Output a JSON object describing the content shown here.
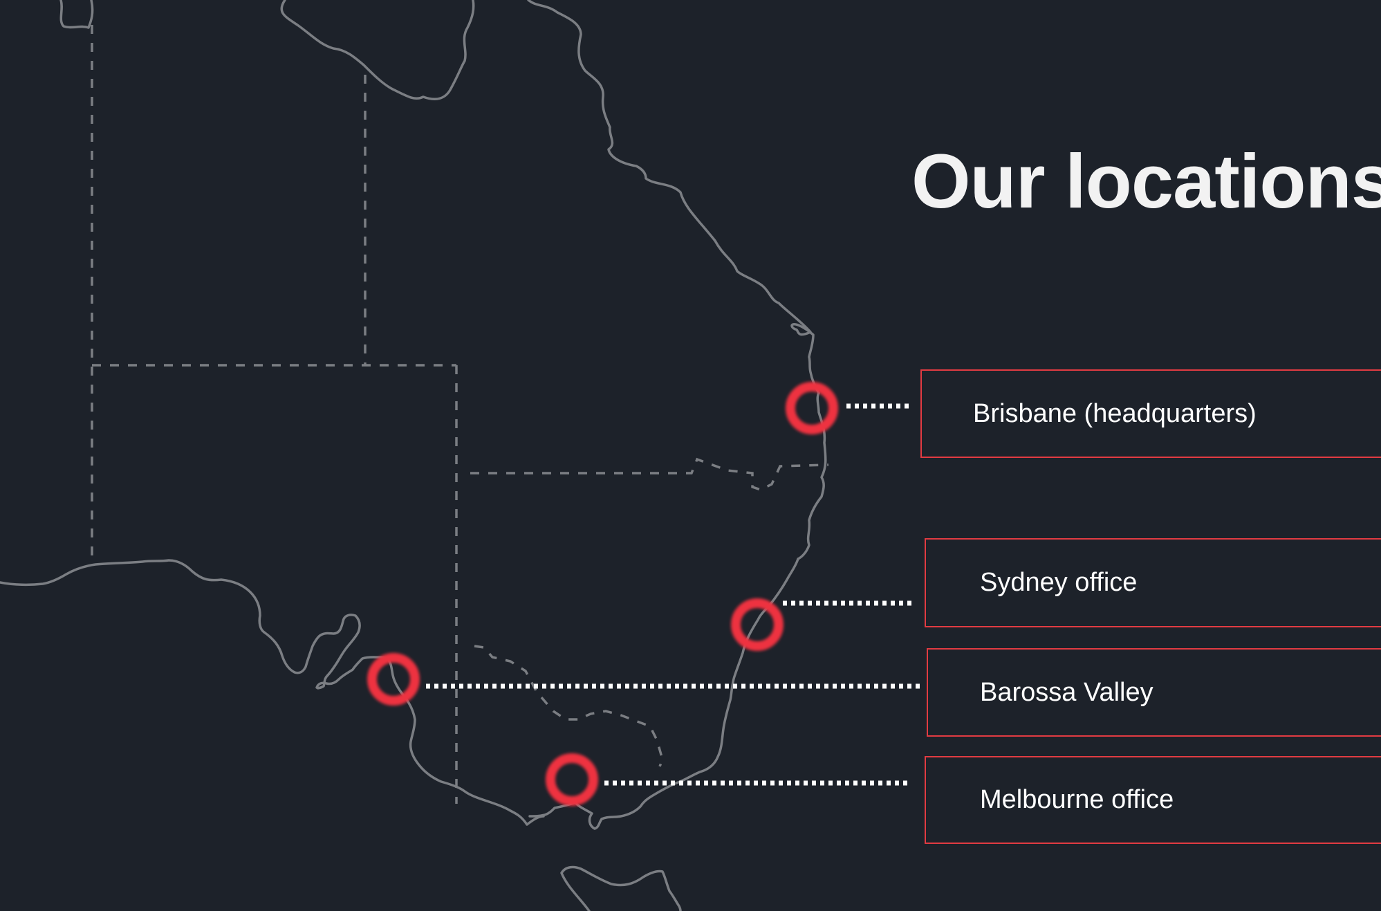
{
  "title": "Our locations",
  "colors": {
    "background": "#1d222a",
    "pin": "#ee3340",
    "box_border": "#e23b42",
    "coastline": "#7b7e83",
    "leader_line": "#ffffff"
  },
  "locations": [
    {
      "label": "Brisbane (headquarters)"
    },
    {
      "label": "Sydney office"
    },
    {
      "label": "Barossa Valley"
    },
    {
      "label": "Melbourne office"
    }
  ]
}
